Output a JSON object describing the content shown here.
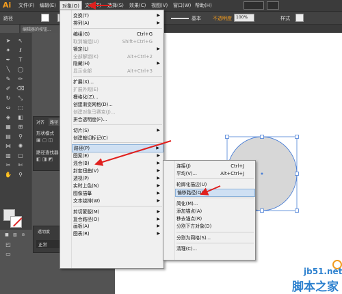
{
  "app": {
    "logo": "Ai"
  },
  "menubar": [
    {
      "label": "文件(F)",
      "active": false
    },
    {
      "label": "编辑(E)",
      "active": false
    },
    {
      "label": "对象(O)",
      "active": true
    },
    {
      "label": "文字(T)",
      "active": false
    },
    {
      "label": "选择(S)",
      "active": false
    },
    {
      "label": "效果(C)",
      "active": false
    },
    {
      "label": "视图(V)",
      "active": false
    },
    {
      "label": "窗口(W)",
      "active": false
    },
    {
      "label": "帮助(H)",
      "active": false
    }
  ],
  "controlbar": {
    "selection_label": "路径",
    "stroke_style": "基本",
    "opacity_label": "不透明度",
    "opacity_value": "100%",
    "style_label": "样式"
  },
  "doc_tab": {
    "title": "编辑器的按钮..."
  },
  "panel_a": {
    "tab1": "对齐",
    "tab2": "路径",
    "row1": "形状模式",
    "row2": "路径查找器"
  },
  "panel_b": {
    "tab": "透明度",
    "mode": "正常"
  },
  "object_menu": {
    "items": [
      {
        "label": "变换(T)",
        "shortcut": "",
        "submenu": true,
        "disabled": false
      },
      {
        "label": "排列(A)",
        "shortcut": "",
        "submenu": true,
        "disabled": false
      },
      {
        "sep": true
      },
      {
        "label": "编组(G)",
        "shortcut": "Ctrl+G",
        "submenu": false,
        "disabled": false
      },
      {
        "label": "取消编组(U)",
        "shortcut": "Shift+Ctrl+G",
        "submenu": false,
        "disabled": true
      },
      {
        "label": "锁定(L)",
        "shortcut": "",
        "submenu": true,
        "disabled": false
      },
      {
        "label": "全部解锁(K)",
        "shortcut": "Alt+Ctrl+2",
        "submenu": false,
        "disabled": true
      },
      {
        "label": "隐藏(H)",
        "shortcut": "",
        "submenu": true,
        "disabled": false
      },
      {
        "label": "显示全部",
        "shortcut": "Alt+Ctrl+3",
        "submenu": false,
        "disabled": true
      },
      {
        "sep": true
      },
      {
        "label": "扩展(X)...",
        "shortcut": "",
        "submenu": false,
        "disabled": false
      },
      {
        "label": "扩展外观(E)",
        "shortcut": "",
        "submenu": false,
        "disabled": true
      },
      {
        "label": "栅格化(Z)...",
        "shortcut": "",
        "submenu": false,
        "disabled": false
      },
      {
        "label": "创建渐变网格(D)...",
        "shortcut": "",
        "submenu": false,
        "disabled": false
      },
      {
        "label": "创建对象马赛克(J)...",
        "shortcut": "",
        "submenu": false,
        "disabled": true
      },
      {
        "label": "拼合透明度(F)...",
        "shortcut": "",
        "submenu": false,
        "disabled": false
      },
      {
        "sep": true
      },
      {
        "label": "切片(S)",
        "shortcut": "",
        "submenu": true,
        "disabled": false
      },
      {
        "label": "创建裁切标记(C)",
        "shortcut": "",
        "submenu": false,
        "disabled": false
      },
      {
        "sep": true
      },
      {
        "label": "路径(P)",
        "shortcut": "",
        "submenu": true,
        "disabled": false,
        "highlight": true
      },
      {
        "label": "图案(E)",
        "shortcut": "",
        "submenu": true,
        "disabled": false
      },
      {
        "label": "混合(B)",
        "shortcut": "",
        "submenu": true,
        "disabled": false
      },
      {
        "label": "封套扭曲(V)",
        "shortcut": "",
        "submenu": true,
        "disabled": false
      },
      {
        "label": "透视(P)",
        "shortcut": "",
        "submenu": true,
        "disabled": false
      },
      {
        "label": "实时上色(N)",
        "shortcut": "",
        "submenu": true,
        "disabled": false
      },
      {
        "label": "图像描摹",
        "shortcut": "",
        "submenu": true,
        "disabled": false
      },
      {
        "label": "文本绕排(W)",
        "shortcut": "",
        "submenu": true,
        "disabled": false
      },
      {
        "sep": true
      },
      {
        "label": "剪切蒙版(M)",
        "shortcut": "",
        "submenu": true,
        "disabled": false
      },
      {
        "label": "复合路径(O)",
        "shortcut": "",
        "submenu": true,
        "disabled": false
      },
      {
        "label": "画板(A)",
        "shortcut": "",
        "submenu": true,
        "disabled": false
      },
      {
        "label": "图表(R)",
        "shortcut": "",
        "submenu": true,
        "disabled": false
      }
    ]
  },
  "path_submenu": {
    "items": [
      {
        "label": "连接(J)",
        "shortcut": "Ctrl+J",
        "disabled": false
      },
      {
        "label": "平均(V)...",
        "shortcut": "Alt+Ctrl+J",
        "disabled": false
      },
      {
        "sep": true
      },
      {
        "label": "轮廓化描边(U)",
        "shortcut": "",
        "disabled": false
      },
      {
        "label": "偏移路径(O)...",
        "shortcut": "",
        "disabled": false,
        "highlight": true
      },
      {
        "sep": true
      },
      {
        "label": "简化(M)...",
        "shortcut": "",
        "disabled": false
      },
      {
        "label": "添加锚点(A)",
        "shortcut": "",
        "disabled": false
      },
      {
        "label": "移去锚点(R)",
        "shortcut": "",
        "disabled": false
      },
      {
        "label": "分割下方对象(D)",
        "shortcut": "",
        "disabled": false
      },
      {
        "sep": true
      },
      {
        "label": "分割为网格(S)...",
        "shortcut": "",
        "disabled": false
      },
      {
        "sep": true
      },
      {
        "label": "清理(C)...",
        "shortcut": "",
        "disabled": false
      }
    ]
  },
  "watermark": {
    "line1": "jb51.net",
    "line2": "脚本之家"
  },
  "colors": {
    "accent_orange": "#f29b1e",
    "menu_highlight": "#cfe0f3",
    "arrow_red": "#e0201e",
    "watermark_blue": "#2f82cf"
  }
}
